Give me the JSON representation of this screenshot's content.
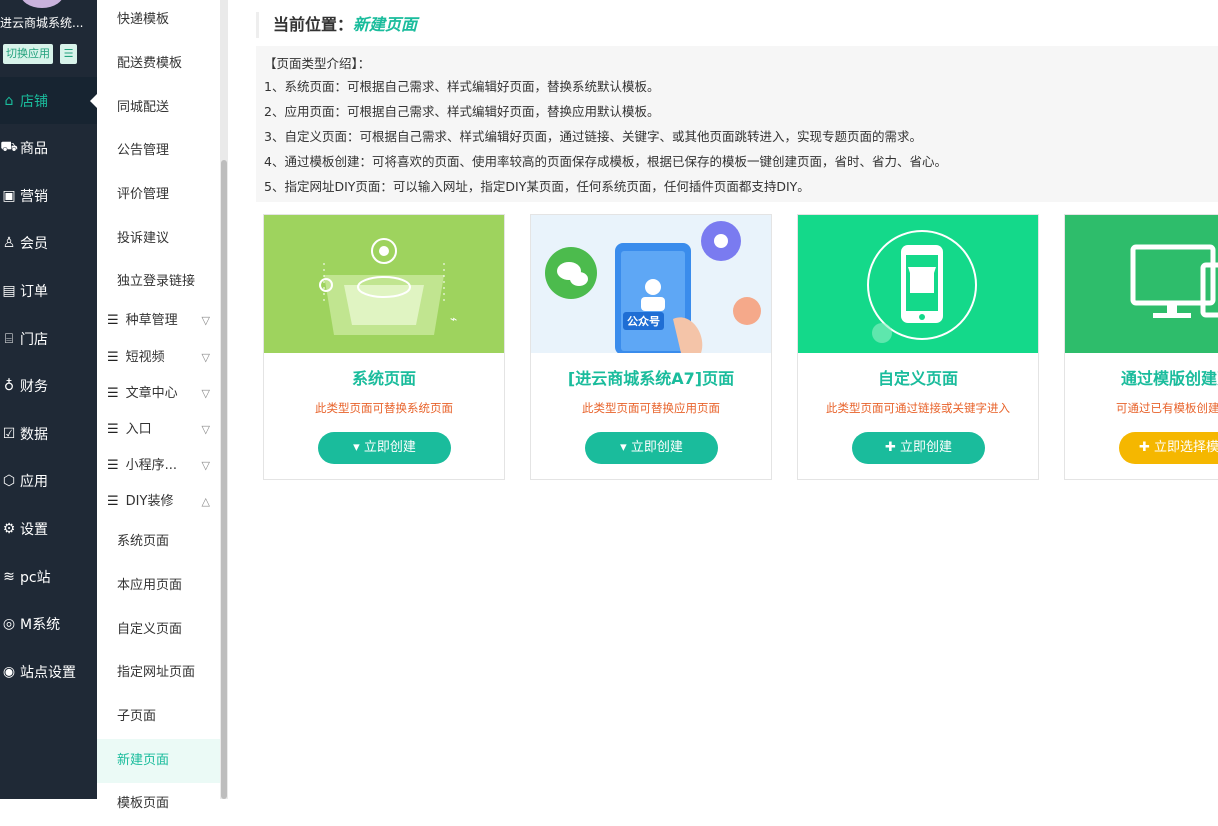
{
  "nav": {
    "shop_name": "进云商城系统...",
    "switch_label": "切换应用",
    "items": [
      {
        "label": "店铺",
        "icon": "shop-icon",
        "active": true
      },
      {
        "label": "商品",
        "icon": "cart-icon"
      },
      {
        "label": "营销",
        "icon": "marketing-icon"
      },
      {
        "label": "会员",
        "icon": "member-icon"
      },
      {
        "label": "订单",
        "icon": "order-icon"
      },
      {
        "label": "门店",
        "icon": "store-icon"
      },
      {
        "label": "财务",
        "icon": "finance-icon"
      },
      {
        "label": "数据",
        "icon": "data-icon"
      },
      {
        "label": "应用",
        "icon": "app-icon"
      },
      {
        "label": "设置",
        "icon": "gear-icon"
      },
      {
        "label": "pc站",
        "icon": "pc-icon"
      },
      {
        "label": "M系统",
        "icon": "m-system-icon"
      },
      {
        "label": "站点设置",
        "icon": "site-settings-icon"
      }
    ]
  },
  "submenu": {
    "top_items": [
      "快递模板",
      "配送费模板",
      "同城配送",
      "公告管理",
      "评价管理",
      "投诉建议",
      "独立登录链接"
    ],
    "groups": [
      "种草管理",
      "短视频",
      "文章中心",
      "入口",
      "小程序...",
      "DIY装修"
    ],
    "diy_items": [
      "系统页面",
      "本应用页面",
      "自定义页面",
      "指定网址页面",
      "子页面",
      "新建页面",
      "模板页面"
    ]
  },
  "breadcrumb": {
    "label": "当前位置：",
    "current": "新建页面"
  },
  "intro": {
    "heading": "【页面类型介绍】：",
    "lines": [
      "1、系统页面：可根据自己需求、样式编辑好页面，替换系统默认模板。",
      "2、应用页面：可根据自己需求、样式编辑好页面，替换应用默认模板。",
      "3、自定义页面：可根据自己需求、样式编辑好页面，通过链接、关键字、或其他页面跳转进入，实现专题页面的需求。",
      "4、通过模板创建：可将喜欢的页面、使用率较高的页面保存成模板，根据已保存的模板一键创建页面，省时、省力、省心。",
      "5、指定网址DIY页面：可以输入网址，指定DIY某页面，任何系统页面，任何插件页面都支持DIY。"
    ]
  },
  "cards": [
    {
      "title": "系统页面",
      "desc": "此类型页面可替换系统页面",
      "button": "立即创建"
    },
    {
      "title": "[进云商城系统A7]页面",
      "desc": "此类型页面可替换应用页面",
      "button": "立即创建",
      "badge": "公众号"
    },
    {
      "title": "自定义页面",
      "desc": "此类型页面可通过链接或关键字进入",
      "button": "立即创建"
    },
    {
      "title": "通过模版创建页面",
      "desc": "可通过已有模板创建新页面",
      "button": "立即选择模板"
    }
  ],
  "colors": {
    "accent": "#1abc9c",
    "nav_bg": "#1f2936",
    "warn": "#e8632b",
    "yellow": "#f5b700"
  }
}
